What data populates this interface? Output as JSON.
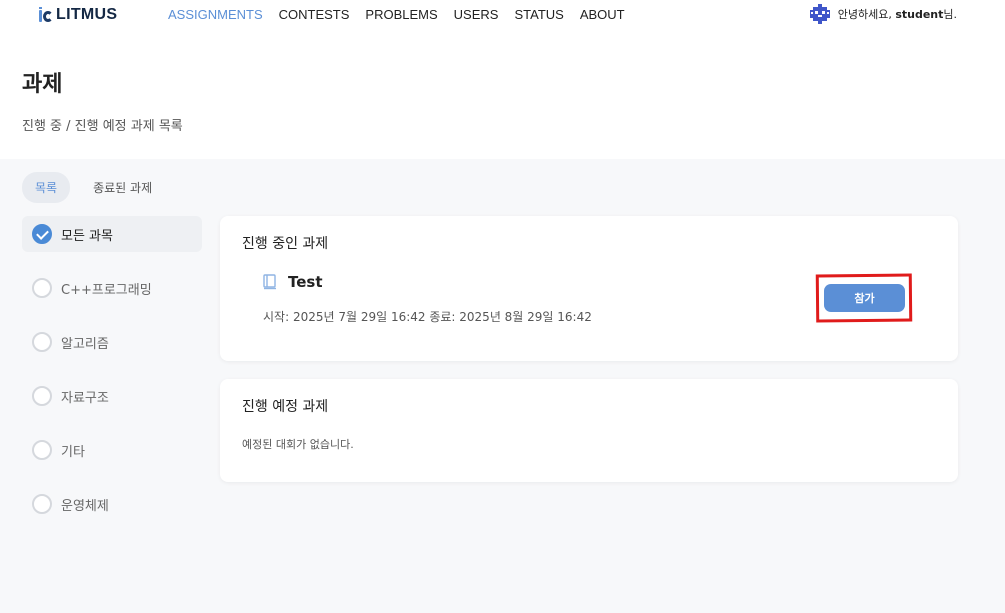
{
  "nav": {
    "logo_text": "LITMUS",
    "items": [
      {
        "label": "ASSIGNMENTS",
        "active": true
      },
      {
        "label": "CONTESTS"
      },
      {
        "label": "PROBLEMS"
      },
      {
        "label": "USERS"
      },
      {
        "label": "STATUS"
      },
      {
        "label": "ABOUT"
      }
    ],
    "greeting_prefix": "안녕하세요, ",
    "username": "student",
    "greeting_suffix": "님."
  },
  "header": {
    "title": "과제",
    "subtitle": "진행 중 / 진행 예정 과제 목록"
  },
  "tabs": [
    {
      "label": "목록",
      "active": true
    },
    {
      "label": "종료된 과제"
    }
  ],
  "sidebar": {
    "items": [
      {
        "label": "모든 과목",
        "checked": true
      },
      {
        "label": "C++프로그래밍"
      },
      {
        "label": "알고리즘"
      },
      {
        "label": "자료구조"
      },
      {
        "label": "기타"
      },
      {
        "label": "운영체제"
      }
    ]
  },
  "ongoing": {
    "title": "진행 중인 과제",
    "assignment": {
      "name": "Test",
      "period": "시작: 2025년 7월 29일 16:42  종료: 2025년 8월 29일 16:42",
      "join_label": "참가"
    }
  },
  "upcoming": {
    "title": "진행 예정 과제",
    "empty_message": "예정된 대회가 없습니다."
  },
  "colors": {
    "accent": "#5b8fd6",
    "highlight": "#e01b1b"
  }
}
